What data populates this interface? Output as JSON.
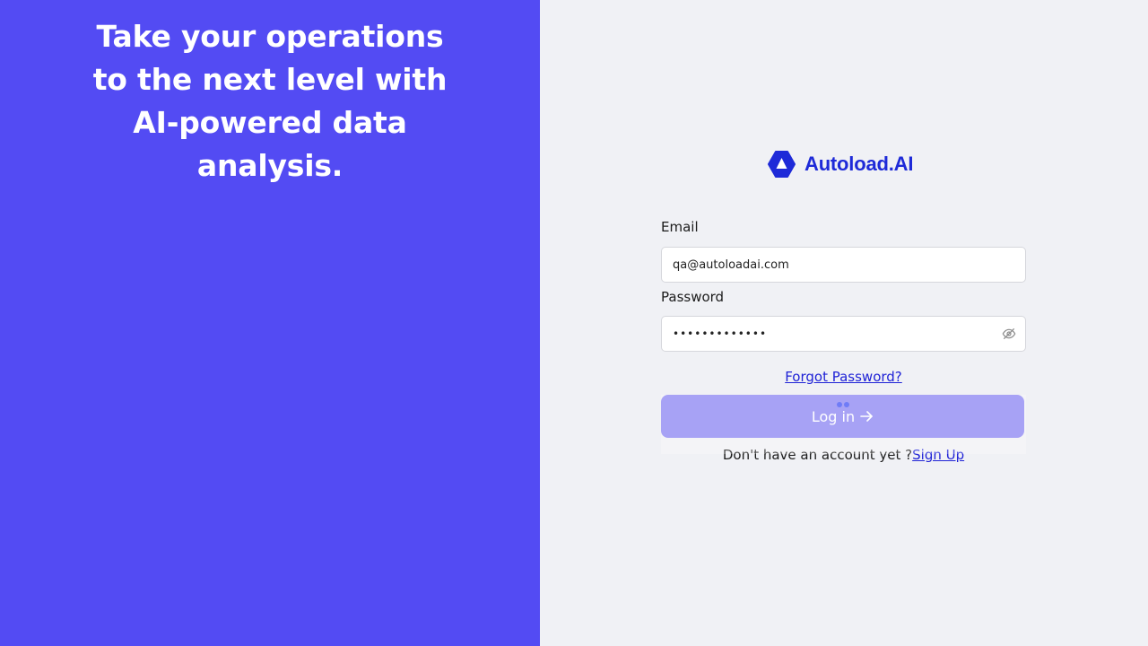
{
  "hero": {
    "headline": "Take your operations to the next level with AI-powered data analysis."
  },
  "brand": {
    "name": "Autoload.AI",
    "logo_icon": "autoload-logo-icon",
    "color": "#1e2ad8"
  },
  "form": {
    "email_label": "Email",
    "email_value": "qa@autoloadai.com",
    "password_label": "Password",
    "password_value": "•••••••••••••",
    "password_toggle_icon": "eye-off-icon",
    "forgot_password": "Forgot Password?",
    "login_label": "Log in",
    "login_icon": "arrow-right-icon",
    "loading_icon": "loading-spinner-icon",
    "signup_prompt": "Don't have an account yet ?",
    "signup_link": "Sign Up"
  },
  "colors": {
    "left_panel": "#534bf3",
    "right_panel": "#f0f1f5",
    "link": "#1f22d6",
    "button_disabled": "#a7a2f5"
  }
}
